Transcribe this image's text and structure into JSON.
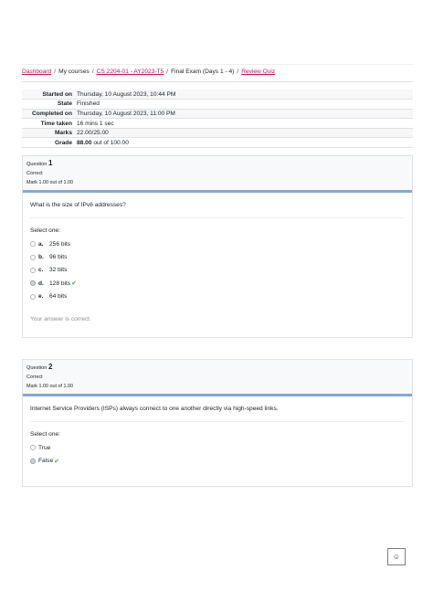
{
  "breadcrumb": {
    "dashboard": "Dashboard",
    "my_courses": "My courses",
    "course": "CS 2204-01 - AY2023-T5",
    "exam": "Final Exam (Days 1 - 4)",
    "review": "Review Quiz",
    "separator": "/"
  },
  "summary": [
    {
      "label": "Started on",
      "value": "Thursday, 10 August 2023, 10:44 PM"
    },
    {
      "label": "State",
      "value": "Finished"
    },
    {
      "label": "Completed on",
      "value": "Thursday, 10 August 2023, 11:00 PM"
    },
    {
      "label": "Time taken",
      "value": "16 mins 1 sec"
    },
    {
      "label": "Marks",
      "value": "22.00/25.00"
    },
    {
      "label": "Grade",
      "value_bold": "88.00",
      "value_rest": "out of 100.00"
    }
  ],
  "questions": [
    {
      "question_word": "Question",
      "number": "1",
      "status": "Correct",
      "mark": "Mark 1.00 out of 1.00",
      "text": "What is the size of IPv6 addresses?",
      "prompt": "Select one:",
      "options": [
        {
          "letter": "a.",
          "label": "256 bits"
        },
        {
          "letter": "b.",
          "label": "96 bits"
        },
        {
          "letter": "c.",
          "label": "32 bits"
        },
        {
          "letter": "d.",
          "label": "128 bits",
          "selected": true,
          "correct": true
        },
        {
          "letter": "e.",
          "label": "64 bits"
        }
      ],
      "feedback": "Your answer is correct."
    },
    {
      "question_word": "Question",
      "number": "2",
      "status": "Correct",
      "mark": "Mark 1.00 out of 1.00",
      "text": "Internet Service Providers (ISPs) always connect to one another directly via high-speed links.",
      "prompt": "Select one:",
      "options": [
        {
          "label": "True"
        },
        {
          "label": "False",
          "selected": true,
          "correct": true
        }
      ]
    }
  ],
  "icons": {
    "tick": "✔",
    "back_to_top": "☺"
  },
  "colors": {
    "link": "#c2185b",
    "correct_tick": "#5aa732",
    "info_bar": "#84a9cf"
  }
}
